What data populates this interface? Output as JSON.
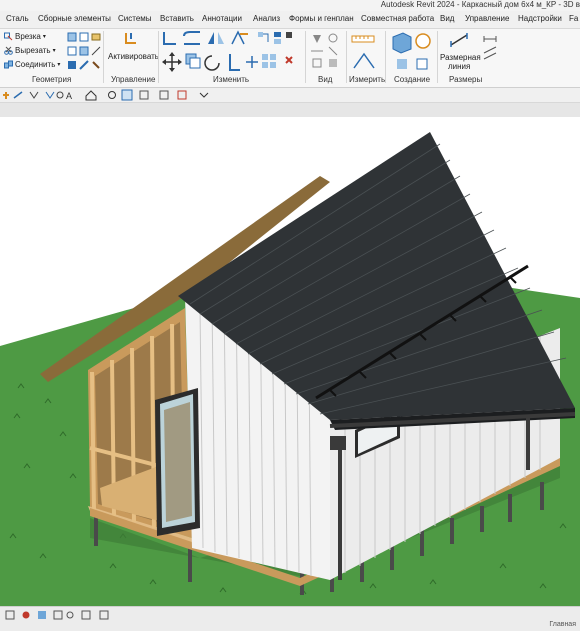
{
  "window": {
    "title": "Autodesk Revit 2024 - Каркасный дом 6х4 м_КР - 3D в"
  },
  "menu": {
    "tabs": [
      "Сталь",
      "Сборные элементы",
      "Системы",
      "Вставить",
      "Аннотации",
      "Анализ",
      "Формы и генплан",
      "Совместная работа",
      "Вид",
      "Управление",
      "Надстройки",
      "Fa"
    ]
  },
  "ribbon": {
    "geometry": {
      "cut": "Врезка",
      "cut_out": "Вырезать",
      "join": "Соединить",
      "label": "Геометрия"
    },
    "control": {
      "activate": "Активировать",
      "label": "Управление"
    },
    "modify": {
      "label": "Изменить"
    },
    "view": {
      "label": "Вид"
    },
    "measure": {
      "label": "Измерить"
    },
    "create": {
      "label": "Создание"
    },
    "dimensions": {
      "aligned_line1": "Размерная",
      "aligned_line2": "линия",
      "label": "Размеры"
    }
  },
  "statusbar": {
    "right_label": "Главная"
  },
  "colors": {
    "grass": "#4e9a44",
    "roof": "#2f3336",
    "siding": "#f3f3f3",
    "timber": "#d7a96b"
  },
  "icons": [
    "cut-icon",
    "cut-out-icon",
    "join-icon",
    "activate-icon",
    "align-icon",
    "offset-icon",
    "mirror-icon",
    "move-icon",
    "rotate-icon",
    "trim-icon",
    "copy-icon",
    "delete-icon",
    "pin-icon",
    "scale-icon",
    "array-icon",
    "split-icon",
    "view-icon",
    "measure-icon",
    "create-icon",
    "aligned-dimension-icon",
    "home-icon",
    "settings-icon"
  ]
}
